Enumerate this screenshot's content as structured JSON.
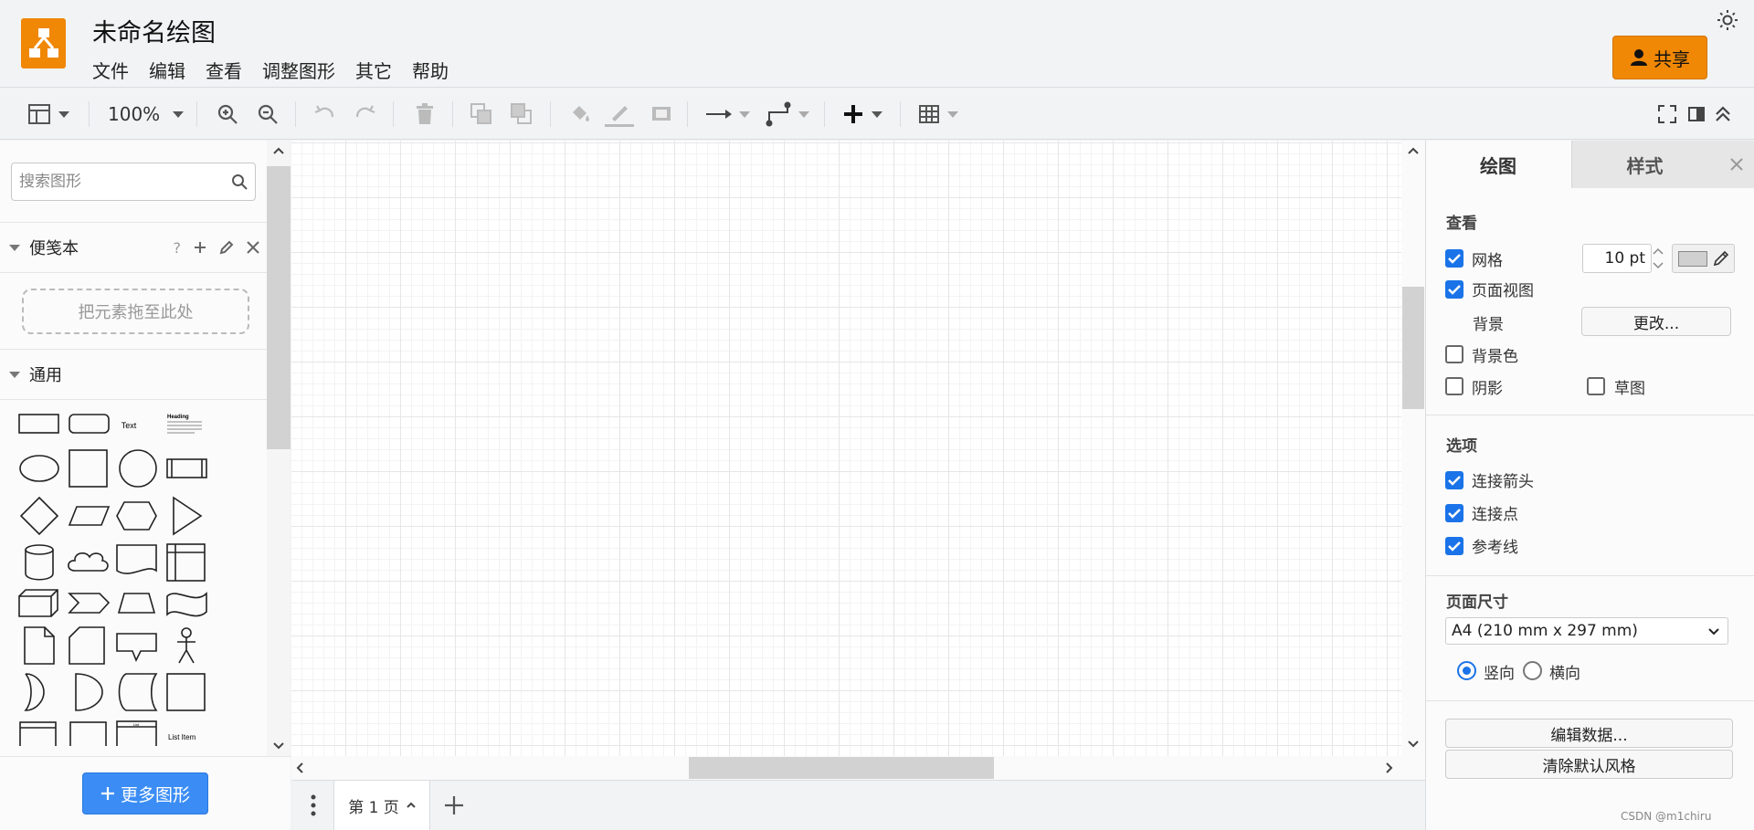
{
  "header": {
    "title": "未命名绘图",
    "menus": [
      "文件",
      "编辑",
      "查看",
      "调整图形",
      "其它",
      "帮助"
    ],
    "share_label": "共享",
    "brand_color": "#f08705"
  },
  "toolbar": {
    "zoom": "100%",
    "icons": [
      "format-icon",
      "zoom-in-icon",
      "zoom-out-icon",
      "undo-icon",
      "redo-icon",
      "delete-icon",
      "to-front-icon",
      "to-back-icon",
      "fill-color-icon",
      "line-color-icon",
      "shadow-icon",
      "connection-icon",
      "waypoints-icon",
      "insert-icon",
      "table-icon",
      "fullscreen-icon",
      "format-panel-icon",
      "collapse-icon"
    ]
  },
  "sidebar": {
    "search_placeholder": "搜索图形",
    "scratchpad": {
      "title": "便笺本",
      "help": "?",
      "drop_hint": "把元素拖至此处"
    },
    "general": {
      "title": "通用",
      "text_shape_label": "Text",
      "heading_shape_label": "Heading",
      "list_shape_label": "List",
      "list_item_label": "List Item"
    },
    "more_shapes_label": "更多图形"
  },
  "pages": {
    "current_page": "第 1 页"
  },
  "format_panel": {
    "tabs": [
      "绘图",
      "样式"
    ],
    "view_section": {
      "title": "查看",
      "grid_label": "网格",
      "grid_checked": true,
      "grid_size": "10 pt",
      "page_view_label": "页面视图",
      "page_view_checked": true,
      "background_label": "背景",
      "change_button": "更改...",
      "bg_color_label": "背景色",
      "bg_color_checked": false,
      "shadow_label": "阴影",
      "shadow_checked": false,
      "sketch_label": "草图",
      "sketch_checked": false
    },
    "options_section": {
      "title": "选项",
      "connection_arrows_label": "连接箭头",
      "connection_points_label": "连接点",
      "guides_label": "参考线"
    },
    "page_size_section": {
      "title": "页面尺寸",
      "selected_size": "A4 (210 mm x 297 mm)",
      "portrait_label": "竖向",
      "landscape_label": "横向",
      "orientation": "portrait"
    },
    "edit_data_button": "编辑数据...",
    "clear_style_button": "清除默认风格",
    "accent_color": "#1a73e8"
  },
  "watermark": "CSDN @m1chiru"
}
